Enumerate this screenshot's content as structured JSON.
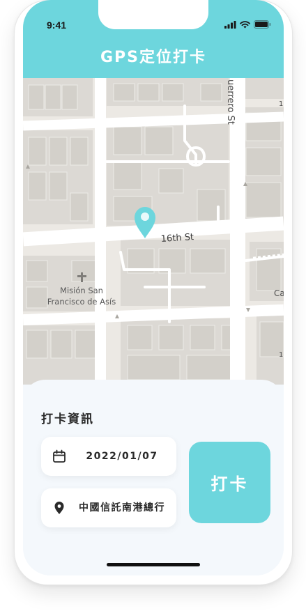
{
  "status_bar": {
    "time": "9:41"
  },
  "header": {
    "title": "GPS定位打卡"
  },
  "map": {
    "streets": {
      "guerrero": "uerrero St",
      "sixteenth": "16th St",
      "cut_right": "Ca",
      "edge_num_1": "1",
      "edge_num_2": "1"
    },
    "landmark": {
      "line1": "Misión San",
      "line2": "Francisco de Asís"
    },
    "marker_icon": "location-pin-icon",
    "marker_color": "#6dd6dd"
  },
  "panel": {
    "section_title": "打卡資訊",
    "date_icon": "calendar-icon",
    "date": "2022/01/07",
    "location_icon": "location-pin-icon",
    "location": "中國信託南港總行",
    "checkin_label": "打卡"
  },
  "colors": {
    "accent": "#6dd6dd",
    "panel_bg": "#f4f8fc"
  }
}
